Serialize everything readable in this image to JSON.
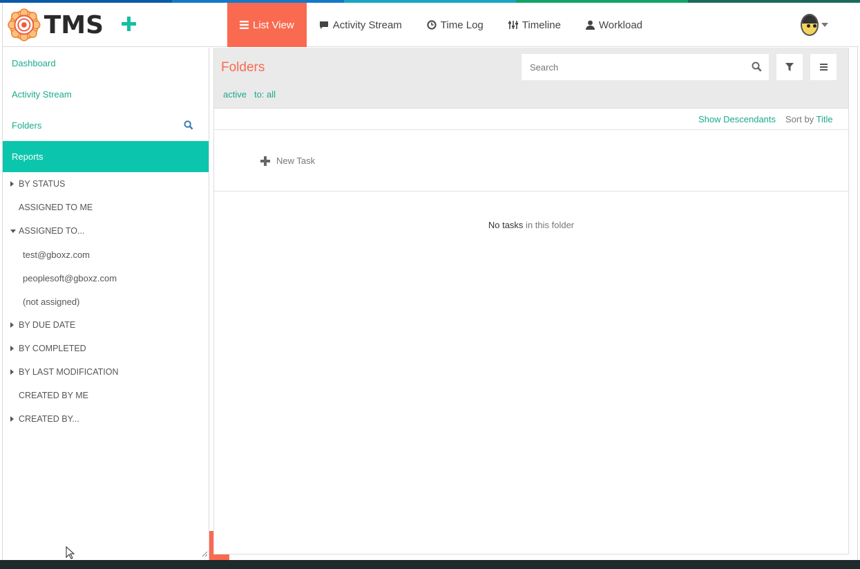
{
  "colors": {
    "accent": "#fa6a50",
    "teal": "#0bc6ac",
    "link": "#1aaa8c",
    "stripe": [
      "#0a5aa8",
      "#1478c8",
      "#16a7c0",
      "#11a36a",
      "#1a8a5c"
    ]
  },
  "header": {
    "logo_text": "TMS",
    "add_icon": "plus-icon",
    "nav": [
      {
        "label": "List View",
        "icon": "list-icon",
        "active": true
      },
      {
        "label": "Activity Stream",
        "icon": "comment-icon",
        "active": false
      },
      {
        "label": "Time Log",
        "icon": "clock-icon",
        "active": false
      },
      {
        "label": "Timeline",
        "icon": "sliders-icon",
        "active": false
      },
      {
        "label": "Workload",
        "icon": "user-icon",
        "active": false
      }
    ]
  },
  "sidebar": {
    "links": [
      {
        "label": "Dashboard"
      },
      {
        "label": "Activity Stream"
      },
      {
        "label": "Folders"
      },
      {
        "label": "Reports"
      }
    ],
    "reports": [
      {
        "label": "BY STATUS",
        "toggle": "collapsed"
      },
      {
        "label": "ASSIGNED TO ME",
        "toggle": "none"
      },
      {
        "label": "ASSIGNED TO...",
        "toggle": "expanded"
      },
      {
        "label": "test@gboxz.com",
        "toggle": "child"
      },
      {
        "label": "peoplesoft@gboxz.com",
        "toggle": "child"
      },
      {
        "label": "(not assigned)",
        "toggle": "child"
      },
      {
        "label": "BY DUE DATE",
        "toggle": "collapsed"
      },
      {
        "label": "BY COMPLETED",
        "toggle": "collapsed"
      },
      {
        "label": "BY LAST MODIFICATION",
        "toggle": "collapsed"
      },
      {
        "label": "CREATED BY ME",
        "toggle": "none"
      },
      {
        "label": "CREATED BY...",
        "toggle": "collapsed"
      }
    ]
  },
  "main": {
    "title": "Folders",
    "search_placeholder": "Search",
    "filters": [
      "active",
      "to: all"
    ],
    "show_descendants": "Show Descendants",
    "sort_label": "Sort by",
    "sort_value": "Title",
    "new_task": "New Task",
    "empty_strong": "No tasks",
    "empty_rest": " in this folder"
  }
}
